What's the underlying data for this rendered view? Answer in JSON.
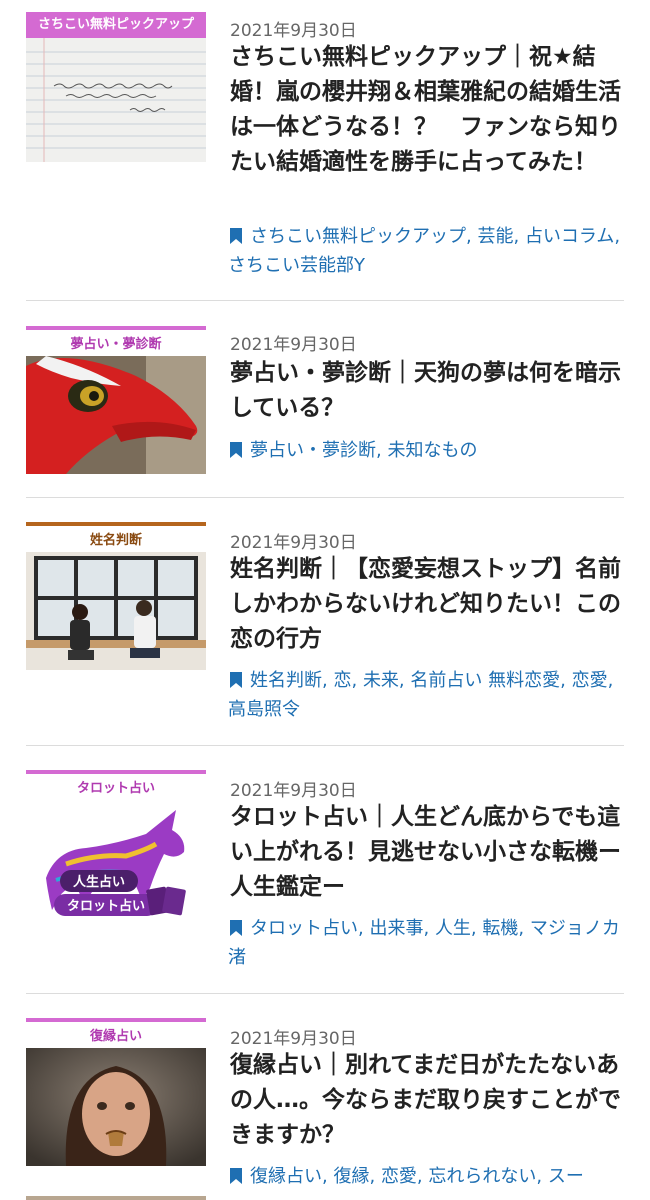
{
  "posts": [
    {
      "category_label": "さちこい無料ピックアップ",
      "category_style": "magenta-fill",
      "date": "2021年9月30日",
      "title": "さちこい無料ピックアップ｜祝★結婚！嵐の櫻井翔＆相葉雅紀の結婚生活は一体どうなる！？　ファンなら知りたい結婚適性を勝手に占ってみた！",
      "thumb_note": "御結婚 おめでとうございます。(イラストは じゃんけん〜) by さちこい",
      "tags": [
        "さちこい無料ピックアップ,",
        "芸能,",
        "占いコラム,",
        "さちこい芸能部Y"
      ]
    },
    {
      "category_label": "夢占い・夢診断",
      "date": "2021年9月30日",
      "title": "夢占い・夢診断｜天狗の夢は何を暗示している？",
      "tags": [
        "夢占い・夢診断,",
        "未知なもの"
      ]
    },
    {
      "category_label": "姓名判断",
      "date": "2021年9月30日",
      "title": "姓名判断｜【恋愛妄想ストップ】名前しかわからないけれど知りたい！この恋の行方",
      "tags": [
        "姓名判断,",
        "恋,",
        "未来,",
        "名前占い 無料恋愛,",
        "恋愛,",
        "高島照令"
      ]
    },
    {
      "category_label": "タロット占い",
      "date": "2021年9月30日",
      "title": "タロット占い｜人生どん底からでも這い上がれる！見逃せない小さな転機ー人生鑑定ー",
      "thumb_badge_1": "人生占い",
      "thumb_badge_2": "タロット占い",
      "tags": [
        "タロット占い,",
        "出来事,",
        "人生,",
        "転機,",
        "マジョノカ渚"
      ]
    },
    {
      "category_label": "復縁占い",
      "date": "2021年9月30日",
      "title": "復縁占い｜別れてまだ日がたたないあの人…。今ならまだ取り戻すことができますか？",
      "tags": [
        "復縁占い,",
        "復縁,",
        "恋愛,",
        "忘れられない,",
        "スー"
      ]
    }
  ],
  "colors": {
    "tag_link": "#1f6fb2",
    "category_border_pink": "#d46ad2",
    "category_border_brown": "#b5651d"
  }
}
